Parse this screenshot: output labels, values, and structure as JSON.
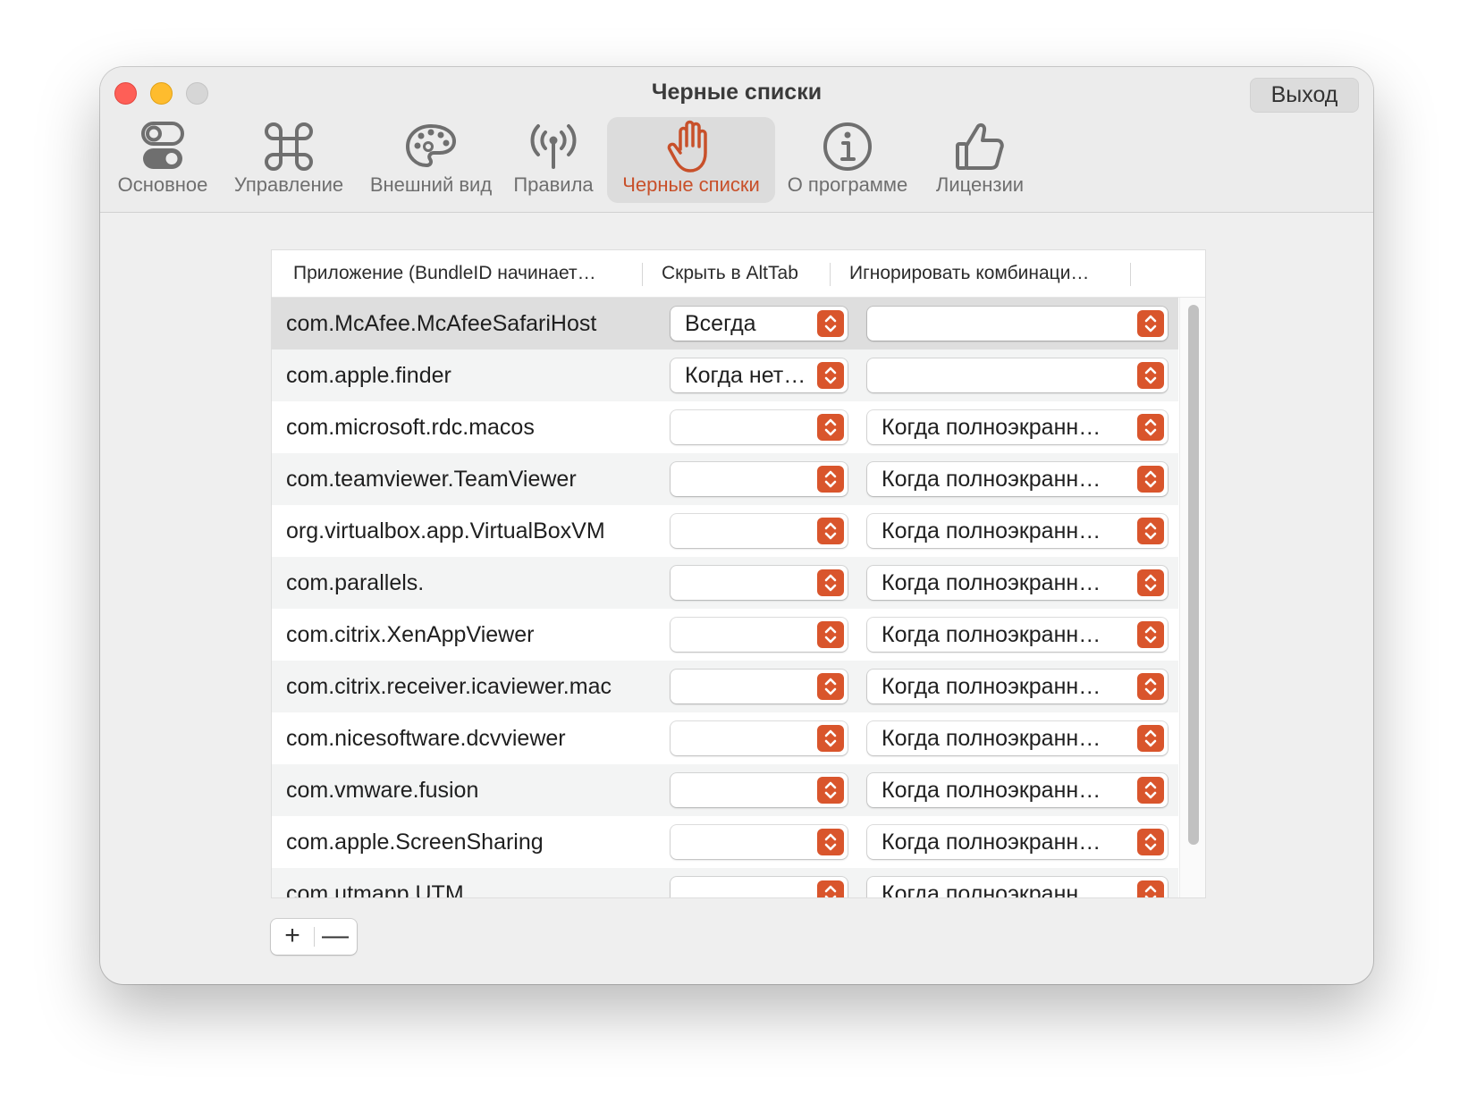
{
  "window": {
    "title": "Черные списки",
    "quit_label": "Выход"
  },
  "tabs": [
    {
      "label": "Основное",
      "icon": "toggles-icon"
    },
    {
      "label": "Управление",
      "icon": "command-icon"
    },
    {
      "label": "Внешний вид",
      "icon": "palette-icon"
    },
    {
      "label": "Правила",
      "icon": "antenna-icon"
    },
    {
      "label": "Черные списки",
      "icon": "hand-icon",
      "selected": true
    },
    {
      "label": "О программе",
      "icon": "info-icon"
    },
    {
      "label": "Лицензии",
      "icon": "thumbs-up-icon"
    }
  ],
  "table": {
    "headers": [
      "Приложение (BundleID начинает…",
      "Скрыть в AltTab",
      "Игнорировать комбинаци…"
    ],
    "rows": [
      {
        "app": "com.McAfee.McAfeeSafariHost",
        "hide": "Всегда",
        "ignore": ""
      },
      {
        "app": "com.apple.finder",
        "hide": "Когда нет…",
        "ignore": ""
      },
      {
        "app": "com.microsoft.rdc.macos",
        "hide": "",
        "ignore": "Когда полноэкранн…"
      },
      {
        "app": "com.teamviewer.TeamViewer",
        "hide": "",
        "ignore": "Когда полноэкранн…"
      },
      {
        "app": "org.virtualbox.app.VirtualBoxVM",
        "hide": "",
        "ignore": "Когда полноэкранн…"
      },
      {
        "app": "com.parallels.",
        "hide": "",
        "ignore": "Когда полноэкранн…"
      },
      {
        "app": "com.citrix.XenAppViewer",
        "hide": "",
        "ignore": "Когда полноэкранн…"
      },
      {
        "app": "com.citrix.receiver.icaviewer.mac",
        "hide": "",
        "ignore": "Когда полноэкранн…"
      },
      {
        "app": "com.nicesoftware.dcvviewer",
        "hide": "",
        "ignore": "Когда полноэкранн…"
      },
      {
        "app": "com.vmware.fusion",
        "hide": "",
        "ignore": "Когда полноэкранн…"
      },
      {
        "app": "com.apple.ScreenSharing",
        "hide": "",
        "ignore": "Когда полноэкранн…"
      },
      {
        "app": "com.utmapp.UTM",
        "hide": "",
        "ignore": "Когда полноэкранн…"
      }
    ]
  },
  "buttons": {
    "add": "+",
    "remove": "—"
  },
  "colors": {
    "accent": "#d9552c",
    "selected_tab_text": "#c8502a"
  }
}
